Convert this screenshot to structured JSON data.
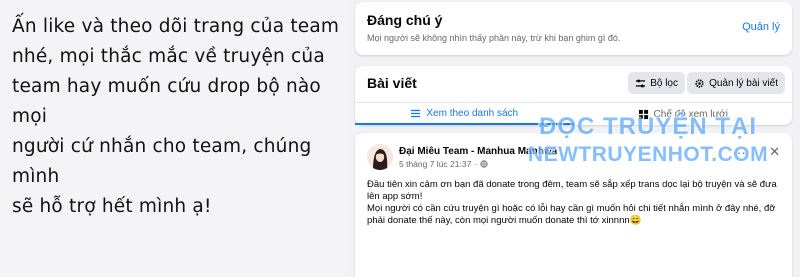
{
  "note": {
    "lines": [
      "Ấn like và theo dõi trang của team",
      "nhé, mọi thắc mắc về truyện của",
      "team hay muốn cứu drop bộ nào mọi",
      "người cứ nhắn cho team, chúng mình",
      "sẽ hỗ trợ hết mình ạ!"
    ]
  },
  "pinned": {
    "title": "Đáng chú ý",
    "description": "Mọi người sẽ không nhìn thấy phần này, trừ khi bạn ghim gì đó.",
    "manage_label": "Quản lý"
  },
  "posts": {
    "title": "Bài viết",
    "filter_label": "Bộ lọc",
    "manage_label": "Quản lý bài viết",
    "tabs": [
      {
        "label": "Xem theo danh sách",
        "active": true
      },
      {
        "label": "Chế độ xem lưới",
        "active": false
      }
    ]
  },
  "post": {
    "author": "Đại Miêu Team - Manhua Manhwa",
    "timestamp": "5 tháng 7 lúc 21:37",
    "more_glyph": "···",
    "close_glyph": "✕",
    "body": [
      "Đầu tiên xin cảm ơn bạn đã donate trong đêm, team sẽ sắp xếp trans dọc lại bộ truyện và sẽ đưa lên app sớm!",
      "Mọi người có cần cứu truyện gì hoặc có lỗi hay cần gì muốn hỏi chi tiết nhắn mình ở đây nhé, đỡ phải donate thế này, còn mọi người muốn donate thì tớ xinnnn😄"
    ]
  },
  "watermark": {
    "line1": "ĐỌC TRUYỆN TẠI",
    "line2": "NEWTRUYENHOT.COM"
  }
}
